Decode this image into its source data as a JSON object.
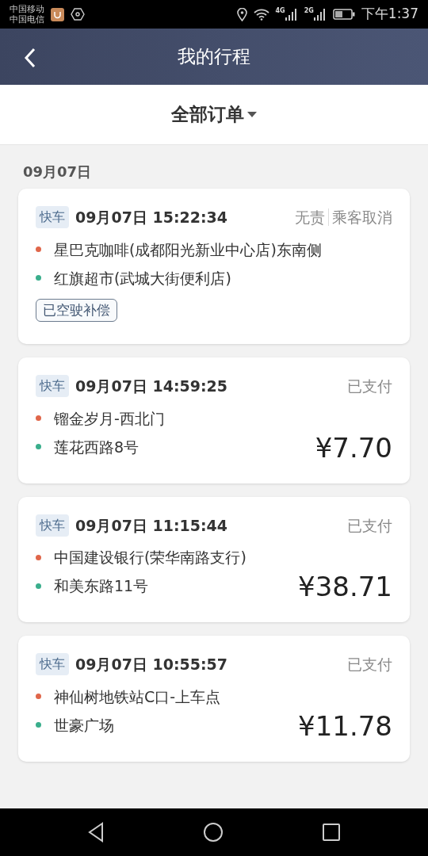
{
  "status_bar": {
    "carriers": [
      "中国移动",
      "中国电信"
    ],
    "network_labels": [
      "4G",
      "2G"
    ],
    "time": "下午1:37"
  },
  "header": {
    "title": "我的行程"
  },
  "filter": {
    "label": "全部订单"
  },
  "section_date": "09月07日",
  "trips": [
    {
      "tag": "快车",
      "datetime": "09月07日 15:22:34",
      "status": [
        "无责",
        "乘客取消"
      ],
      "stops": [
        {
          "name": "星巴克咖啡(成都阳光新业中心店)东南侧",
          "color": "#e0664a"
        },
        {
          "name": "红旗超市(武城大街便利店)",
          "color": "#3aae8c"
        }
      ],
      "note": "已空驶补偿"
    },
    {
      "tag": "快车",
      "datetime": "09月07日 14:59:25",
      "status": [
        "已支付"
      ],
      "stops": [
        {
          "name": "镏金岁月-西北门",
          "color": "#e0664a"
        },
        {
          "name": "莲花西路8号",
          "color": "#3aae8c"
        }
      ],
      "price": "¥7.70"
    },
    {
      "tag": "快车",
      "datetime": "09月07日 11:15:44",
      "status": [
        "已支付"
      ],
      "stops": [
        {
          "name": "中国建设银行(荣华南路支行)",
          "color": "#e0664a"
        },
        {
          "name": "和美东路11号",
          "color": "#3aae8c"
        }
      ],
      "price": "¥38.71"
    },
    {
      "tag": "快车",
      "datetime": "09月07日 10:55:57",
      "status": [
        "已支付"
      ],
      "stops": [
        {
          "name": "神仙树地铁站C口-上车点",
          "color": "#e0664a"
        },
        {
          "name": "世豪广场",
          "color": "#3aae8c"
        }
      ],
      "price": "¥11.78"
    }
  ]
}
